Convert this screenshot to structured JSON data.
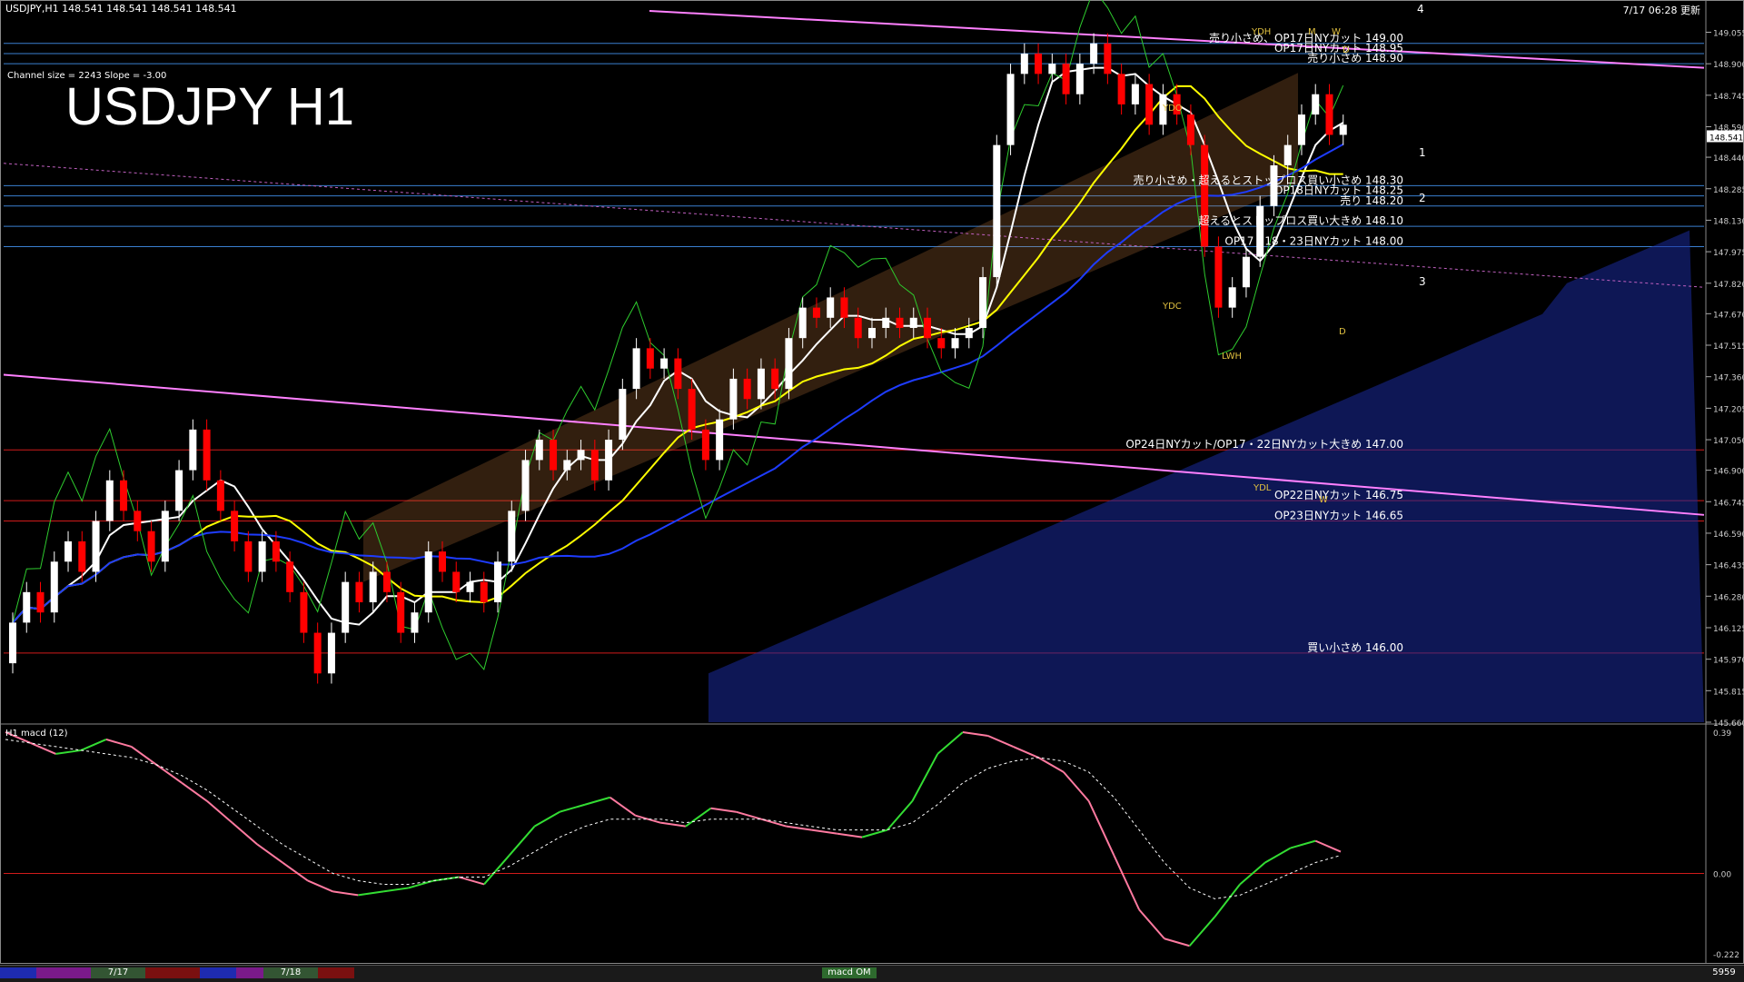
{
  "header": {
    "symbol_line": "USDJPY,H1  148.541 148.541 148.541 148.541",
    "update_time": "7/17 06:28 更新",
    "channel_info": "Channel size = 2243 Slope = -3.00",
    "chart_title": "USDJPY H1"
  },
  "macd_panel": {
    "label": "H1 macd (12)",
    "scale": [
      "0.39",
      "0.00",
      "-0.222"
    ]
  },
  "bottom_bar": {
    "date_tabs": [
      "7/17",
      "7/18"
    ],
    "indicator_tab": "macd OM",
    "right_value": "5959"
  },
  "current_price": "148.541",
  "colors": {
    "background": "#000000",
    "bull_candle": "#ffffff",
    "bear_candle": "#ff0000",
    "price_line_blue": "#1e3cff",
    "ma_yellow": "#ffff00",
    "ma_white": "#ffffff",
    "channel_magenta": "#ff80ff",
    "green_line": "#2ecc2e",
    "cloud_blue": "#1a2a9a"
  },
  "chart_data": [
    {
      "type": "candlestick",
      "title": "USDJPY H1",
      "y_axis_ticks": [
        "149.055",
        "148.900",
        "148.745",
        "148.590",
        "148.440",
        "148.285",
        "148.130",
        "147.975",
        "147.820",
        "147.670",
        "147.515",
        "147.360",
        "147.205",
        "147.050",
        "146.900",
        "146.745",
        "146.590",
        "146.435",
        "146.280",
        "146.125",
        "145.970",
        "145.815",
        "145.660"
      ],
      "ylim": [
        145.66,
        149.16
      ],
      "price_levels": [
        {
          "label": "売り小さめ、OP17日NYカット 149.00",
          "value": 149.0
        },
        {
          "label": "OP17日NYカット 148.95",
          "value": 148.95
        },
        {
          "label": "売り小さめ 148.90",
          "value": 148.9
        },
        {
          "label": "売り小さめ・超えるとストップロス買い小さめ 148.30",
          "value": 148.3
        },
        {
          "label": "OP18日NYカット 148.25",
          "value": 148.25
        },
        {
          "label": "売り 148.20",
          "value": 148.2
        },
        {
          "label": "超えるとストップロス買い大きめ 148.10",
          "value": 148.1
        },
        {
          "label": "OP17・18・23日NYカット 148.00",
          "value": 148.0
        },
        {
          "label": "OP24日NYカット/OP17・22日NYカット大きめ 147.00",
          "value": 147.0
        },
        {
          "label": "OP22日NYカット 146.75",
          "value": 146.75
        },
        {
          "label": "OP23日NYカット 146.65",
          "value": 146.65
        },
        {
          "label": "買い小さめ 146.00",
          "value": 146.0
        }
      ],
      "markers": [
        "YDH",
        "M",
        "W",
        "D",
        "YDO",
        "YDC",
        "LWH",
        "YDL",
        "W",
        "D"
      ],
      "channel_numbers": [
        "4",
        "1",
        "2",
        "3"
      ],
      "candles": [
        [
          145.95,
          146.15
        ],
        [
          146.15,
          146.3
        ],
        [
          146.3,
          146.2
        ],
        [
          146.2,
          146.45
        ],
        [
          146.45,
          146.55
        ],
        [
          146.55,
          146.4
        ],
        [
          146.4,
          146.65
        ],
        [
          146.65,
          146.85
        ],
        [
          146.85,
          146.7
        ],
        [
          146.7,
          146.6
        ],
        [
          146.6,
          146.45
        ],
        [
          146.45,
          146.7
        ],
        [
          146.7,
          146.9
        ],
        [
          146.9,
          147.1
        ],
        [
          147.1,
          146.85
        ],
        [
          146.85,
          146.7
        ],
        [
          146.7,
          146.55
        ],
        [
          146.55,
          146.4
        ],
        [
          146.4,
          146.55
        ],
        [
          146.55,
          146.45
        ],
        [
          146.45,
          146.3
        ],
        [
          146.3,
          146.1
        ],
        [
          146.1,
          145.9
        ],
        [
          145.9,
          146.1
        ],
        [
          146.1,
          146.35
        ],
        [
          146.35,
          146.25
        ],
        [
          146.25,
          146.4
        ],
        [
          146.4,
          146.3
        ],
        [
          146.3,
          146.1
        ],
        [
          146.1,
          146.2
        ],
        [
          146.2,
          146.5
        ],
        [
          146.5,
          146.4
        ],
        [
          146.4,
          146.3
        ],
        [
          146.3,
          146.35
        ],
        [
          146.35,
          146.25
        ],
        [
          146.25,
          146.45
        ],
        [
          146.45,
          146.7
        ],
        [
          146.7,
          146.95
        ],
        [
          146.95,
          147.05
        ],
        [
          147.05,
          146.9
        ],
        [
          146.9,
          146.95
        ],
        [
          146.95,
          147.0
        ],
        [
          147.0,
          146.85
        ],
        [
          146.85,
          147.05
        ],
        [
          147.05,
          147.3
        ],
        [
          147.3,
          147.5
        ],
        [
          147.5,
          147.4
        ],
        [
          147.4,
          147.45
        ],
        [
          147.45,
          147.3
        ],
        [
          147.3,
          147.1
        ],
        [
          147.1,
          146.95
        ],
        [
          146.95,
          147.15
        ],
        [
          147.15,
          147.35
        ],
        [
          147.35,
          147.25
        ],
        [
          147.25,
          147.4
        ],
        [
          147.4,
          147.3
        ],
        [
          147.3,
          147.55
        ],
        [
          147.55,
          147.7
        ],
        [
          147.7,
          147.65
        ],
        [
          147.65,
          147.75
        ],
        [
          147.75,
          147.65
        ],
        [
          147.65,
          147.55
        ],
        [
          147.55,
          147.6
        ],
        [
          147.6,
          147.65
        ],
        [
          147.65,
          147.6
        ],
        [
          147.6,
          147.65
        ],
        [
          147.65,
          147.55
        ],
        [
          147.55,
          147.5
        ],
        [
          147.5,
          147.55
        ],
        [
          147.55,
          147.6
        ],
        [
          147.6,
          147.85
        ],
        [
          147.85,
          148.5
        ],
        [
          148.5,
          148.85
        ],
        [
          148.85,
          148.95
        ],
        [
          148.95,
          148.85
        ],
        [
          148.85,
          148.9
        ],
        [
          148.9,
          148.75
        ],
        [
          148.75,
          148.9
        ],
        [
          148.9,
          149.0
        ],
        [
          149.0,
          148.85
        ],
        [
          148.85,
          148.7
        ],
        [
          148.7,
          148.8
        ],
        [
          148.8,
          148.6
        ],
        [
          148.6,
          148.75
        ],
        [
          148.75,
          148.65
        ],
        [
          148.65,
          148.5
        ],
        [
          148.5,
          148.0
        ],
        [
          148.0,
          147.7
        ],
        [
          147.7,
          147.8
        ],
        [
          147.8,
          147.95
        ],
        [
          147.95,
          148.2
        ],
        [
          148.2,
          148.4
        ],
        [
          148.4,
          148.5
        ],
        [
          148.5,
          148.65
        ],
        [
          148.65,
          148.75
        ],
        [
          148.75,
          148.55
        ],
        [
          148.55,
          148.6
        ]
      ]
    },
    {
      "type": "line",
      "title": "H1 macd (12)",
      "ylim": [
        -0.222,
        0.39
      ],
      "series": [
        {
          "values": [
            0.39,
            0.36,
            0.33,
            0.34,
            0.37,
            0.35,
            0.3,
            0.25,
            0.2,
            0.14,
            0.08,
            0.03,
            -0.02,
            -0.05,
            -0.06,
            -0.05,
            -0.04,
            -0.02,
            -0.01,
            -0.03,
            0.05,
            0.13,
            0.17,
            0.19,
            0.21,
            0.16,
            0.14,
            0.13,
            0.18,
            0.17,
            0.15,
            0.13,
            0.12,
            0.11,
            0.1,
            0.12,
            0.2,
            0.33,
            0.39,
            0.38,
            0.35,
            0.32,
            0.28,
            0.2,
            0.05,
            -0.1,
            -0.18,
            -0.2,
            -0.12,
            -0.03,
            0.03,
            0.07,
            0.09,
            0.06
          ]
        },
        {
          "values": [
            0.37,
            0.36,
            0.35,
            0.34,
            0.33,
            0.32,
            0.3,
            0.27,
            0.23,
            0.18,
            0.13,
            0.08,
            0.04,
            0.0,
            -0.02,
            -0.03,
            -0.03,
            -0.02,
            -0.01,
            -0.01,
            0.02,
            0.06,
            0.1,
            0.13,
            0.15,
            0.15,
            0.15,
            0.14,
            0.15,
            0.15,
            0.15,
            0.14,
            0.13,
            0.12,
            0.12,
            0.12,
            0.14,
            0.19,
            0.25,
            0.29,
            0.31,
            0.32,
            0.31,
            0.28,
            0.21,
            0.12,
            0.03,
            -0.04,
            -0.07,
            -0.06,
            -0.03,
            0.0,
            0.03,
            0.05
          ]
        }
      ]
    }
  ]
}
